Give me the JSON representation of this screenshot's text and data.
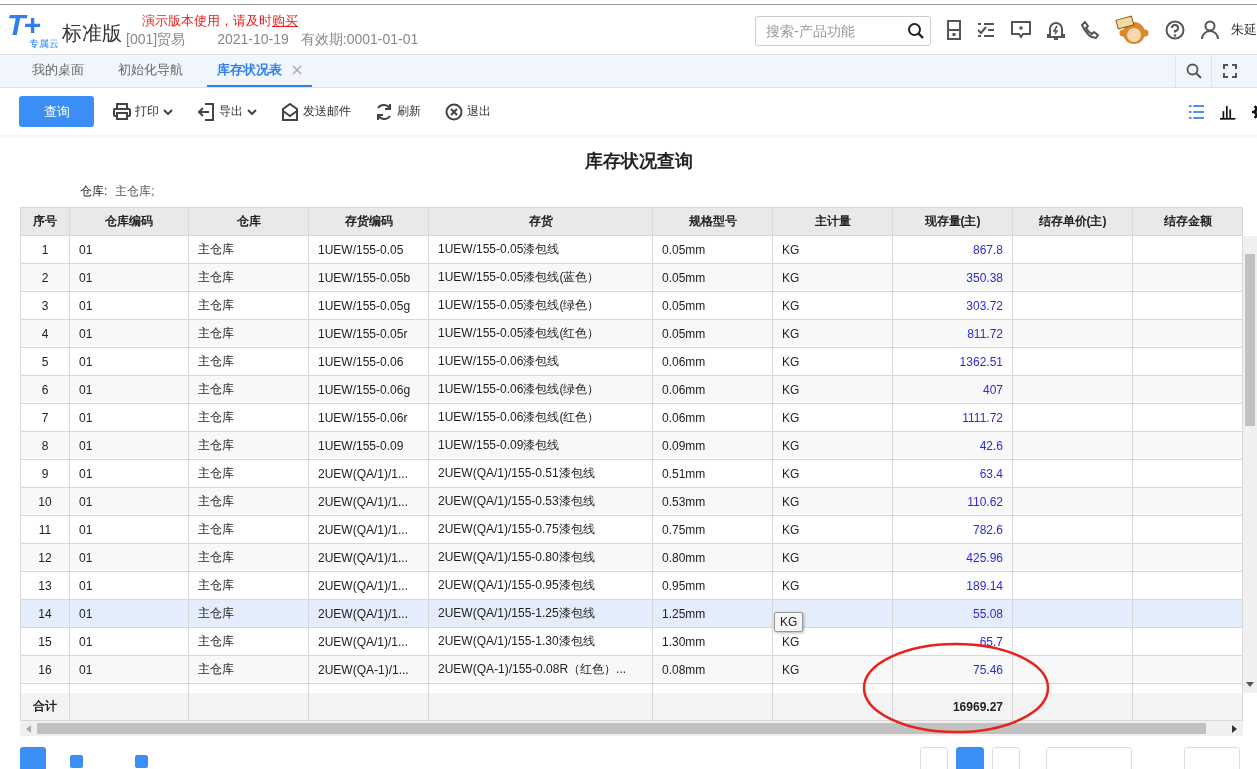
{
  "header": {
    "logo_mark": "T+",
    "logo_sub": "专属云",
    "edition": "标准版",
    "notice": "演示版本使用，请及时",
    "notice_link": "购买",
    "account": "[001]贸易",
    "date": "2021-10-19",
    "validity": "有效期:0001-01-01",
    "search": {
      "placeholder": "搜索-产品功能"
    },
    "user": "朱延"
  },
  "tabs": [
    {
      "label": "我的桌面",
      "selected": false,
      "closable": false
    },
    {
      "label": "初始化导航",
      "selected": false,
      "closable": false
    },
    {
      "label": "库存状况表",
      "selected": true,
      "closable": true
    }
  ],
  "toolbar": {
    "query_button": "查询",
    "actions": [
      {
        "kind": "print",
        "label": "打印",
        "dropdown": true
      },
      {
        "kind": "export",
        "label": "导出",
        "dropdown": true
      },
      {
        "kind": "mail",
        "label": "发送邮件",
        "dropdown": false
      },
      {
        "kind": "refresh",
        "label": "刷新",
        "dropdown": false
      },
      {
        "kind": "exit",
        "label": "退出",
        "dropdown": false
      }
    ],
    "views": [
      {
        "kind": "list",
        "selected": true
      },
      {
        "kind": "chart",
        "selected": false
      }
    ]
  },
  "report": {
    "title": "库存状况查询",
    "filter_label": "仓库:",
    "filter_value": "主仓库;"
  },
  "table": {
    "columns": [
      "序号",
      "仓库编码",
      "仓库",
      "存货编码",
      "存货",
      "规格型号",
      "主计量",
      "现存量(主)",
      "结存单价(主)",
      "结存金额"
    ],
    "rows": [
      {
        "hovered": false,
        "cells": [
          "1",
          "01",
          "主仓库",
          "1UEW/155-0.05",
          "1UEW/155-0.05漆包线",
          "0.05mm",
          "KG",
          "867.8",
          "",
          ""
        ]
      },
      {
        "hovered": false,
        "cells": [
          "2",
          "01",
          "主仓库",
          "1UEW/155-0.05b",
          "1UEW/155-0.05漆包线(蓝色）",
          "0.05mm",
          "KG",
          "350.38",
          "",
          ""
        ]
      },
      {
        "hovered": false,
        "cells": [
          "3",
          "01",
          "主仓库",
          "1UEW/155-0.05g",
          "1UEW/155-0.05漆包线(绿色）",
          "0.05mm",
          "KG",
          "303.72",
          "",
          ""
        ]
      },
      {
        "hovered": false,
        "cells": [
          "4",
          "01",
          "主仓库",
          "1UEW/155-0.05r",
          "1UEW/155-0.05漆包线(红色）",
          "0.05mm",
          "KG",
          "811.72",
          "",
          ""
        ]
      },
      {
        "hovered": false,
        "cells": [
          "5",
          "01",
          "主仓库",
          "1UEW/155-0.06",
          "1UEW/155-0.06漆包线",
          "0.06mm",
          "KG",
          "1362.51",
          "",
          ""
        ]
      },
      {
        "hovered": false,
        "cells": [
          "6",
          "01",
          "主仓库",
          "1UEW/155-0.06g",
          "1UEW/155-0.06漆包线(绿色）",
          "0.06mm",
          "KG",
          "407",
          "",
          ""
        ]
      },
      {
        "hovered": false,
        "cells": [
          "7",
          "01",
          "主仓库",
          "1UEW/155-0.06r",
          "1UEW/155-0.06漆包线(红色）",
          "0.06mm",
          "KG",
          "1111.72",
          "",
          ""
        ]
      },
      {
        "hovered": false,
        "cells": [
          "8",
          "01",
          "主仓库",
          "1UEW/155-0.09",
          "1UEW/155-0.09漆包线",
          "0.09mm",
          "KG",
          "42.6",
          "",
          ""
        ]
      },
      {
        "hovered": false,
        "cells": [
          "9",
          "01",
          "主仓库",
          "2UEW(QA/1)/1...",
          "2UEW(QA/1)/155-0.51漆包线",
          "0.51mm",
          "KG",
          "63.4",
          "",
          ""
        ]
      },
      {
        "hovered": false,
        "cells": [
          "10",
          "01",
          "主仓库",
          "2UEW(QA/1)/1...",
          "2UEW(QA/1)/155-0.53漆包线",
          "0.53mm",
          "KG",
          "110.62",
          "",
          ""
        ]
      },
      {
        "hovered": false,
        "cells": [
          "11",
          "01",
          "主仓库",
          "2UEW(QA/1)/1...",
          "2UEW(QA/1)/155-0.75漆包线",
          "0.75mm",
          "KG",
          "782.6",
          "",
          ""
        ]
      },
      {
        "hovered": false,
        "cells": [
          "12",
          "01",
          "主仓库",
          "2UEW(QA/1)/1...",
          "2UEW(QA/1)/155-0.80漆包线",
          "0.80mm",
          "KG",
          "425.96",
          "",
          ""
        ]
      },
      {
        "hovered": false,
        "cells": [
          "13",
          "01",
          "主仓库",
          "2UEW(QA/1)/1...",
          "2UEW(QA/1)/155-0.95漆包线",
          "0.95mm",
          "KG",
          "189.14",
          "",
          ""
        ]
      },
      {
        "hovered": true,
        "cells": [
          "14",
          "01",
          "主仓库",
          "2UEW(QA/1)/1...",
          "2UEW(QA/1)/155-1.25漆包线",
          "1.25mm",
          "",
          "55.08",
          "",
          ""
        ],
        "tooltip": "KG"
      },
      {
        "hovered": false,
        "cells": [
          "15",
          "01",
          "主仓库",
          "2UEW(QA/1)/1...",
          "2UEW(QA/1)/155-1.30漆包线",
          "1.30mm",
          "KG",
          "65.7",
          "",
          ""
        ]
      },
      {
        "hovered": false,
        "cells": [
          "16",
          "01",
          "主仓库",
          "2UEW(QA-1)/1...",
          "2UEW(QA-1)/155-0.08R（红色）...",
          "0.08mm",
          "KG",
          "75.46",
          "",
          ""
        ]
      }
    ],
    "total": {
      "label": "合计",
      "value": "16969.27",
      "circled": true
    }
  },
  "footer": {
    "checkboxes": [
      {
        "checked": true
      },
      {
        "checked": true
      }
    ]
  }
}
